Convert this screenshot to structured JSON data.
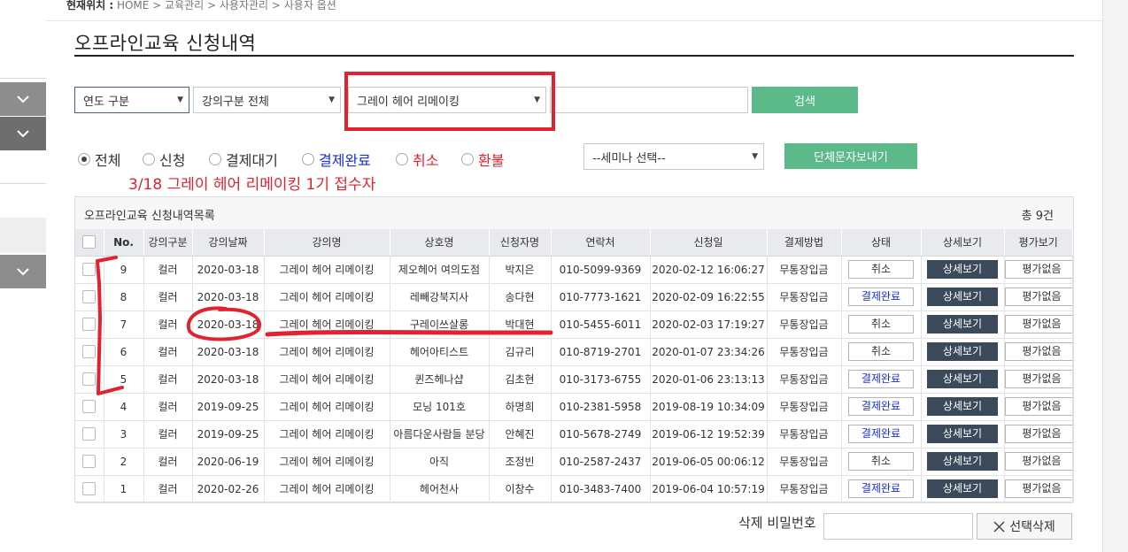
{
  "breadcrumb": {
    "prefix": "현재위치 :",
    "path": " HOME > 교육관리 > 사용자관리 > 사용자 옵션"
  },
  "page_title": "오프라인교육 신청내역",
  "search": {
    "year_select": "연도 구분",
    "category_select": "강의구분 전체",
    "course_select": "그레이 헤어 리메이킹",
    "keyword_value": "",
    "search_button": "검색"
  },
  "filters": [
    {
      "label": "전체",
      "selected": true,
      "color": "default"
    },
    {
      "label": "신청",
      "selected": false,
      "color": "default"
    },
    {
      "label": "결제대기",
      "selected": false,
      "color": "default"
    },
    {
      "label": "결제완료",
      "selected": false,
      "color": "blue"
    },
    {
      "label": "취소",
      "selected": false,
      "color": "red"
    },
    {
      "label": "환불",
      "selected": false,
      "color": "red"
    }
  ],
  "seminar_select": "--세미나 선택--",
  "bulk_sms_button": "단체문자보내기",
  "annotation_text": "3/18 그레이 헤어 리메이킹 1기 접수자",
  "table": {
    "title": "오프라인교육 신청내역목록",
    "total": "총 9건",
    "columns": [
      "No.",
      "강의구분",
      "강의날짜",
      "강의명",
      "상호명",
      "신청자명",
      "연락처",
      "신청일",
      "결제방법",
      "상태",
      "상세보기",
      "평가보기"
    ],
    "rows": [
      {
        "no": "9",
        "type": "컬러",
        "date": "2020-03-18",
        "course": "그레이 헤어 리메이킹",
        "shop": "제오헤어 여의도점",
        "name": "박지은",
        "phone": "010-5099-9369",
        "applied": "2020-02-12 16:06:27",
        "payment": "무통장입금",
        "status": "취소",
        "detail": "상세보기",
        "eval": "평가없음"
      },
      {
        "no": "8",
        "type": "컬러",
        "date": "2020-03-18",
        "course": "그레이 헤어 리메이킹",
        "shop": "레빼강북지사",
        "name": "송다현",
        "phone": "010-7773-1621",
        "applied": "2020-02-09 16:22:55",
        "payment": "무통장입금",
        "status": "결제완료",
        "detail": "상세보기",
        "eval": "평가없음"
      },
      {
        "no": "7",
        "type": "컬러",
        "date": "2020-03-18",
        "course": "그레이 헤어 리메이킹",
        "shop": "구레이쓰살롱",
        "name": "박대현",
        "phone": "010-5455-6011",
        "applied": "2020-02-03 17:19:27",
        "payment": "무통장입금",
        "status": "취소",
        "detail": "상세보기",
        "eval": "평가없음"
      },
      {
        "no": "6",
        "type": "컬러",
        "date": "2020-03-18",
        "course": "그레이 헤어 리메이킹",
        "shop": "헤어아티스트",
        "name": "김규리",
        "phone": "010-8719-2701",
        "applied": "2020-01-07 23:34:26",
        "payment": "무통장입금",
        "status": "취소",
        "detail": "상세보기",
        "eval": "평가없음"
      },
      {
        "no": "5",
        "type": "컬러",
        "date": "2020-03-18",
        "course": "그레이 헤어 리메이킹",
        "shop": "퀸즈헤나샵",
        "name": "김초현",
        "phone": "010-3173-6755",
        "applied": "2020-01-06 23:13:13",
        "payment": "무통장입금",
        "status": "결제완료",
        "detail": "상세보기",
        "eval": "평가없음"
      },
      {
        "no": "4",
        "type": "컬러",
        "date": "2019-09-25",
        "course": "그레이 헤어 리메이킹",
        "shop": "모닝 101호",
        "name": "하명희",
        "phone": "010-2381-5958",
        "applied": "2019-08-19 10:34:09",
        "payment": "무통장입금",
        "status": "결제완료",
        "detail": "상세보기",
        "eval": "평가없음"
      },
      {
        "no": "3",
        "type": "컬러",
        "date": "2019-09-25",
        "course": "그레이 헤어 리메이킹",
        "shop": "아름다운사람들 분당",
        "name": "안혜진",
        "phone": "010-5678-2749",
        "applied": "2019-06-12 19:52:39",
        "payment": "무통장입금",
        "status": "결제완료",
        "detail": "상세보기",
        "eval": "평가없음"
      },
      {
        "no": "2",
        "type": "컬러",
        "date": "2020-06-19",
        "course": "그레이 헤어 리메이킹",
        "shop": "아직",
        "name": "조정빈",
        "phone": "010-2587-2437",
        "applied": "2019-06-05 00:06:12",
        "payment": "무통장입금",
        "status": "취소",
        "detail": "상세보기",
        "eval": "평가없음"
      },
      {
        "no": "1",
        "type": "컬러",
        "date": "2020-02-26",
        "course": "그레이 헤어 리메이킹",
        "shop": "헤어천사",
        "name": "이창수",
        "phone": "010-3483-7400",
        "applied": "2019-06-04 10:57:19",
        "payment": "무통장입금",
        "status": "결제완료",
        "detail": "상세보기",
        "eval": "평가없음"
      }
    ]
  },
  "delete": {
    "password_label": "삭제 비밀번호",
    "password_value": "",
    "button": "선택삭제"
  },
  "colors": {
    "accent_green": "#5cb98a",
    "annotation_red": "#e0232f",
    "detail_button": "#3b4a5a",
    "paid_blue": "#1a2fd6"
  }
}
